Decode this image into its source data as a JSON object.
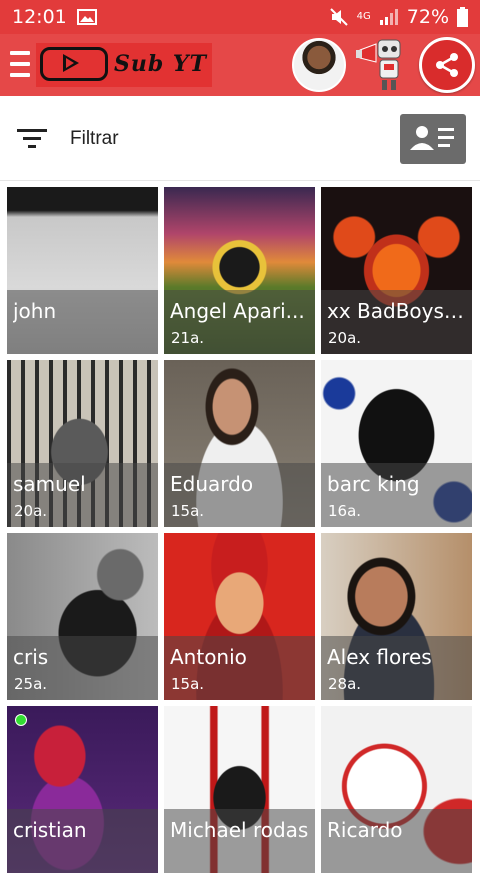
{
  "statusbar": {
    "time": "12:01",
    "network": "4G",
    "battery": "72%",
    "icons": [
      "image-icon",
      "mute-icon",
      "signal-icon",
      "battery-icon"
    ]
  },
  "appbar": {
    "logo_text": "Sub YT",
    "icons": [
      "menu-icon",
      "avatar",
      "robot-megaphone-icon",
      "share-icon"
    ]
  },
  "toolbar": {
    "filter_label": "Filtrar",
    "icons": [
      "filter-icon",
      "contact-card-icon"
    ]
  },
  "colors": {
    "primary": "#e54848",
    "statusbar": "#e23b3b",
    "overlay": "#464646"
  },
  "profiles": [
    {
      "name": "john",
      "age": ""
    },
    {
      "name": "Angel Apari...",
      "age": "21a."
    },
    {
      "name": "xx BadBoys xx",
      "age": "20a."
    },
    {
      "name": "samuel",
      "age": "20a."
    },
    {
      "name": "Eduardo",
      "age": "15a."
    },
    {
      "name": "barc king",
      "age": "16a."
    },
    {
      "name": "cris",
      "age": "25a."
    },
    {
      "name": "Antonio",
      "age": "15a."
    },
    {
      "name": "Alex flores",
      "age": "28a."
    },
    {
      "name": "cristian",
      "age": ""
    },
    {
      "name": "Michael rodas",
      "age": ""
    },
    {
      "name": "Ricardo",
      "age": ""
    }
  ]
}
